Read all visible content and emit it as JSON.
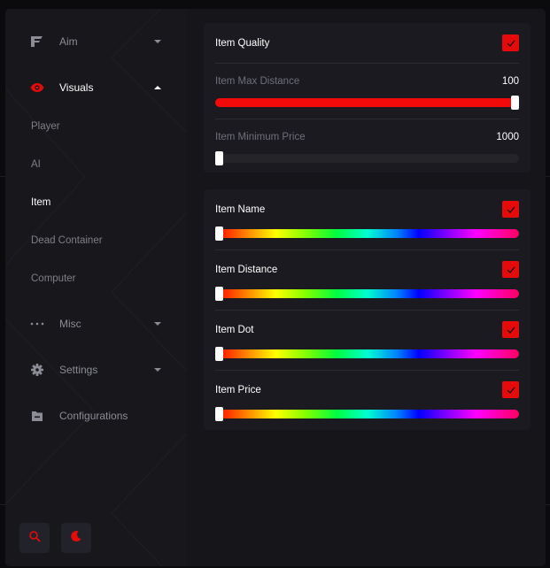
{
  "sidebar": {
    "nav": [
      {
        "label": "Aim",
        "icon": "aim-icon",
        "expanded": false
      },
      {
        "label": "Visuals",
        "icon": "eye-icon",
        "expanded": true
      },
      {
        "label": "Misc",
        "icon": "dots-icon",
        "expanded": false
      },
      {
        "label": "Settings",
        "icon": "gear-icon",
        "expanded": false
      },
      {
        "label": "Configurations",
        "icon": "folder-icon"
      }
    ],
    "visuals_sub": [
      "Player",
      "AI",
      "Item",
      "Dead Container",
      "Computer"
    ],
    "active_sub": "Item",
    "bottom_buttons": [
      "search-icon",
      "moon-icon"
    ]
  },
  "panel1": {
    "quality": {
      "label": "Item Quality",
      "checked": true
    },
    "max_distance": {
      "label": "Item Max Distance",
      "value": "100",
      "fraction": 1.0
    },
    "min_price": {
      "label": "Item Minimum Price",
      "value": "1000",
      "fraction": 0.0
    }
  },
  "panel2": {
    "rows": [
      {
        "label": "Item Name",
        "checked": true
      },
      {
        "label": "Item Distance",
        "checked": true
      },
      {
        "label": "Item Dot",
        "checked": true
      },
      {
        "label": "Item Price",
        "checked": true
      }
    ]
  },
  "colors": {
    "accent": "#e60b0b",
    "background": "#15151a",
    "panel": "#1a1a20"
  }
}
